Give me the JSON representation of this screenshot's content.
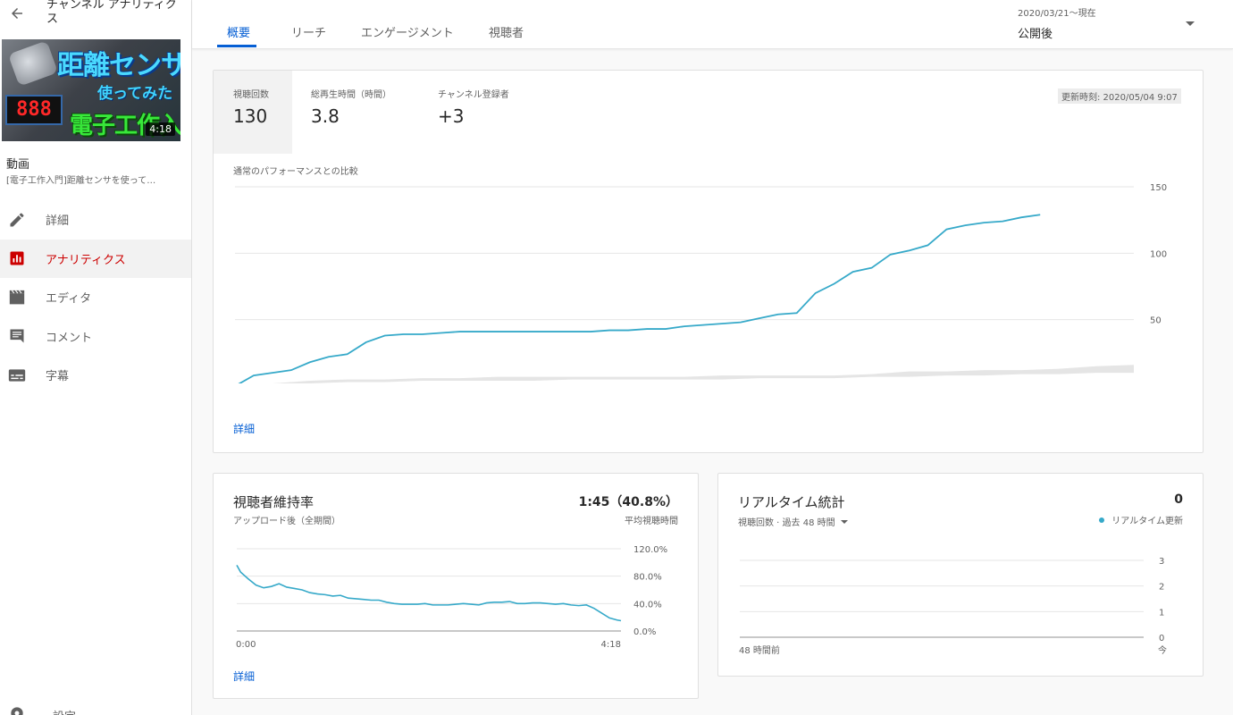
{
  "sidebar": {
    "title": "チャンネル アナリティクス",
    "thumbnail": {
      "line1": "距離センサ",
      "line2": "使ってみた",
      "line3": "電子工作入門",
      "display": "888",
      "duration": "4:18"
    },
    "video_label": "動画",
    "video_title": "[電子工作入門]距離センサを使って…",
    "nav": [
      {
        "label": "詳細",
        "icon": "pencil-icon"
      },
      {
        "label": "アナリティクス",
        "icon": "analytics-icon",
        "active": true
      },
      {
        "label": "エディタ",
        "icon": "film-icon"
      },
      {
        "label": "コメント",
        "icon": "comment-icon"
      },
      {
        "label": "字幕",
        "icon": "subtitles-icon"
      }
    ],
    "bottom_label": "設定"
  },
  "tabs": [
    {
      "label": "概要",
      "active": true
    },
    {
      "label": "リーチ"
    },
    {
      "label": "エンゲージメント"
    },
    {
      "label": "視聴者"
    }
  ],
  "date_range": {
    "dates": "2020/03/21〜現在",
    "label": "公開後"
  },
  "metrics": [
    {
      "label": "視聴回数",
      "value": "130"
    },
    {
      "label": "総再生時間（時間）",
      "value": "3.8"
    },
    {
      "label": "チャンネル登録者",
      "value": "+3"
    }
  ],
  "updated": "更新時刻: 2020/05/04 9:07",
  "comparison_label": "通常のパフォーマンスとの比較",
  "main_detail_link": "詳細",
  "retention": {
    "title": "視聴者維持率",
    "subtitle": "アップロード後（全期間）",
    "value": "1:45（40.8%）",
    "value_label": "平均視聴時間",
    "detail_link": "詳細"
  },
  "realtime": {
    "title": "リアルタイム統計",
    "value": "0",
    "subtitle": "視聴回数 · 過去 48 時間",
    "legend": "リアルタイム更新"
  },
  "colors": {
    "accent": "#065fd4",
    "line": "#36a9c9",
    "band": "#e5e5e5",
    "active_nav": "#cc0000"
  },
  "chart_data": [
    {
      "type": "line",
      "x_unit": "日",
      "xlim": [
        0,
        48
      ],
      "ylim": [
        0,
        150
      ],
      "x_ticks": [
        "0",
        "8",
        "16",
        "24",
        "32",
        "40",
        "48日"
      ],
      "y_ticks": [
        "0",
        "50",
        "100",
        "150"
      ],
      "grid": true,
      "series": [
        {
          "x": [
            0,
            1,
            2,
            3,
            4,
            5,
            6,
            7,
            8,
            9,
            10,
            11,
            12,
            13,
            14,
            15,
            16,
            17,
            18,
            19,
            20,
            21,
            22,
            23,
            24,
            25,
            26,
            27,
            28,
            29,
            30,
            31,
            32,
            33,
            34,
            35,
            36,
            37,
            38,
            39,
            40,
            41,
            42,
            43
          ],
          "y": [
            0,
            8,
            10,
            12,
            18,
            22,
            24,
            33,
            38,
            39,
            39,
            40,
            41,
            41,
            41,
            41,
            41,
            41,
            41,
            41,
            42,
            42,
            43,
            43,
            45,
            46,
            47,
            48,
            51,
            54,
            55,
            70,
            77,
            86,
            89,
            99,
            102,
            106,
            118,
            121,
            123,
            124,
            127,
            129
          ],
          "fill_band": "none"
        }
      ],
      "band": {
        "x": [
          0,
          2,
          4,
          6,
          8,
          10,
          12,
          14,
          16,
          18,
          20,
          22,
          24,
          26,
          28,
          30,
          32,
          34,
          36,
          38,
          40,
          42,
          44,
          46,
          48
        ],
        "low": [
          0,
          1,
          2,
          3,
          3,
          4,
          4,
          4,
          4,
          5,
          5,
          5,
          5,
          5,
          6,
          6,
          6,
          7,
          7,
          8,
          8,
          9,
          9,
          10,
          10
        ],
        "high": [
          0,
          2,
          4,
          5,
          5,
          6,
          6,
          7,
          7,
          7,
          7,
          7,
          7,
          8,
          8,
          8,
          8,
          9,
          11,
          11,
          12,
          12,
          13,
          15,
          16
        ]
      }
    },
    {
      "type": "line",
      "x_ticks": [
        "0:00",
        "4:18"
      ],
      "ylim": [
        0,
        120
      ],
      "y_ticks": [
        "0.0%",
        "40.0%",
        "80.0%",
        "120.0%"
      ],
      "x": [
        0,
        0.01,
        0.03,
        0.05,
        0.07,
        0.09,
        0.11,
        0.13,
        0.15,
        0.17,
        0.19,
        0.21,
        0.23,
        0.25,
        0.27,
        0.29,
        0.31,
        0.33,
        0.35,
        0.37,
        0.39,
        0.41,
        0.43,
        0.45,
        0.47,
        0.49,
        0.51,
        0.53,
        0.55,
        0.57,
        0.59,
        0.61,
        0.63,
        0.65,
        0.67,
        0.69,
        0.71,
        0.73,
        0.75,
        0.77,
        0.79,
        0.81,
        0.83,
        0.85,
        0.87,
        0.89,
        0.91,
        0.93,
        0.95,
        0.97,
        0.99,
        1.0
      ],
      "y": [
        96,
        86,
        76,
        67,
        63,
        65,
        69,
        64,
        62,
        60,
        56,
        54,
        53,
        51,
        52,
        48,
        47,
        46,
        45,
        45,
        42,
        40,
        39,
        39,
        39,
        40,
        38,
        38,
        38,
        39,
        40,
        39,
        38,
        41,
        42,
        42,
        43,
        40,
        40,
        41,
        41,
        40,
        39,
        40,
        38,
        37,
        38,
        33,
        26,
        19,
        16,
        15
      ]
    },
    {
      "type": "line",
      "x_ticks": [
        "48 時間前",
        "今"
      ],
      "ylim": [
        0,
        3
      ],
      "y_ticks": [
        "0",
        "1",
        "2",
        "3"
      ],
      "values": []
    }
  ]
}
